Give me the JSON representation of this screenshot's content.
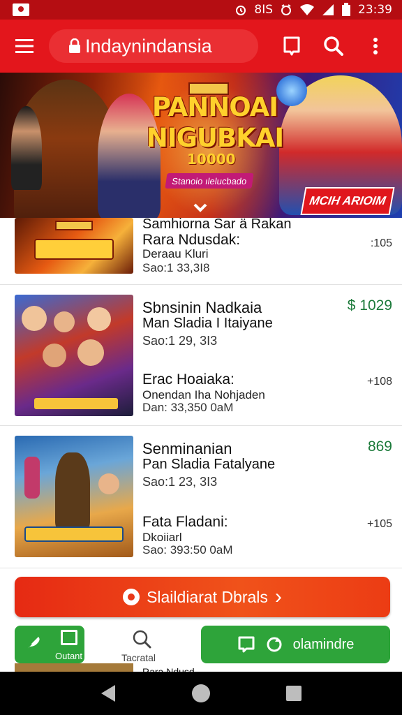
{
  "status_bar": {
    "indicator": "8IS",
    "time": "23:39",
    "icons": [
      "notification-icon",
      "alarm-icon",
      "wifi-icon",
      "signal-icon",
      "battery-icon"
    ]
  },
  "app_bar": {
    "title": "Indaynindansia",
    "icons": [
      "menu-icon",
      "lock-icon",
      "bookmark-icon",
      "search-icon",
      "more-vert-icon"
    ]
  },
  "banner": {
    "badge": "",
    "title_line1": "PANNOAI",
    "title_line2": "NIGUBKAI",
    "number": "10000",
    "tag": "Stanoio ılelucbado",
    "cta": "MCIH ARIOIM"
  },
  "items": [
    {
      "title": "Samhiorna Sar ä Rakan",
      "subtitle": "Rara Ndusdak:",
      "line3": "Deraau Kluri",
      "meta": "Sao:1 33,3I8",
      "price": ":105"
    },
    {
      "title": "Sbnsinin Nadkaia",
      "subtitle": "Man Sladia I Itaiyane",
      "meta": "Sao:1 29, 3I3",
      "price": "$ 1029",
      "title2": "Erac Hoaiaka:",
      "sub2": "Onendan Iha Nohjaden",
      "meta2": "Dan: 33,350 0aM",
      "price2": "+108"
    },
    {
      "title": "Senminanian",
      "subtitle": "Pan Sladia Fatalyane",
      "meta": "Sao:1 23, 3I3",
      "price": "869",
      "title2": "Fata Fladani:",
      "sub2": "Dkoiiarl",
      "meta2": "Sao: 393:50 0aM",
      "price2": "+105"
    }
  ],
  "cta": {
    "label": "Slaildiarat Dbrals",
    "chevron": "›"
  },
  "bottom_bar": {
    "current_label": "Outant",
    "search_label": "Tacratal",
    "green_button_label": "olamindre"
  },
  "peek_text": "Rara Ndusd",
  "colors": {
    "primary_red": "#e3161c",
    "status_red": "#b50d12",
    "accent_green": "#2ea43a",
    "price_green": "#1c7a3a",
    "cta_orange": "#ec3c14"
  }
}
